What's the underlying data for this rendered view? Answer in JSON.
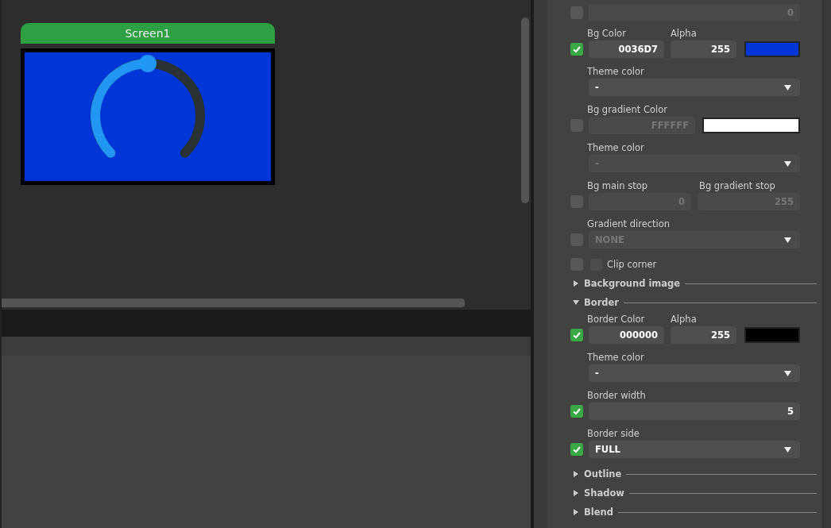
{
  "screen": {
    "title": "Screen1",
    "arc": {
      "level": 0.5
    }
  },
  "properties": [
    {
      "kind": "value",
      "checked": false,
      "disabled": true,
      "value": "0"
    },
    {
      "kind": "color",
      "labels": [
        "Bg Color",
        "Alpha"
      ],
      "checked": true,
      "disabled": false,
      "hex": "0036D7",
      "alpha": "255"
    },
    {
      "kind": "select",
      "labels": [
        "Theme color"
      ],
      "disabled": false,
      "value": "-"
    },
    {
      "kind": "color",
      "labels": [
        "Bg gradient Color"
      ],
      "checked": false,
      "disabled": true,
      "hex": "FFFFFF"
    },
    {
      "kind": "select",
      "labels": [
        "Theme color"
      ],
      "disabled": true,
      "value": "-"
    },
    {
      "kind": "pair",
      "labels": [
        "Bg main stop",
        "Bg gradient stop"
      ],
      "checked": false,
      "disabled": true,
      "values": [
        "0",
        "255"
      ]
    },
    {
      "kind": "select",
      "labels": [
        "Gradient direction"
      ],
      "checked": false,
      "disabled": true,
      "value": "NONE"
    },
    {
      "kind": "check",
      "checked": false,
      "label": "Clip corner"
    },
    {
      "kind": "section",
      "label": "Background image",
      "expanded": false
    },
    {
      "kind": "section",
      "label": "Border",
      "expanded": true
    },
    {
      "kind": "color",
      "labels": [
        "Border Color",
        "Alpha"
      ],
      "checked": true,
      "disabled": false,
      "hex": "000000",
      "alpha": "255"
    },
    {
      "kind": "select",
      "labels": [
        "Theme color"
      ],
      "disabled": false,
      "value": "-"
    },
    {
      "kind": "value",
      "labels": [
        "Border width"
      ],
      "checked": true,
      "disabled": false,
      "value": "5"
    },
    {
      "kind": "select",
      "labels": [
        "Border side"
      ],
      "checked": true,
      "disabled": false,
      "value": "FULL"
    },
    {
      "kind": "section",
      "label": "Outline",
      "expanded": false
    },
    {
      "kind": "section",
      "label": "Shadow",
      "expanded": false
    },
    {
      "kind": "section",
      "label": "Blend",
      "expanded": false
    }
  ]
}
